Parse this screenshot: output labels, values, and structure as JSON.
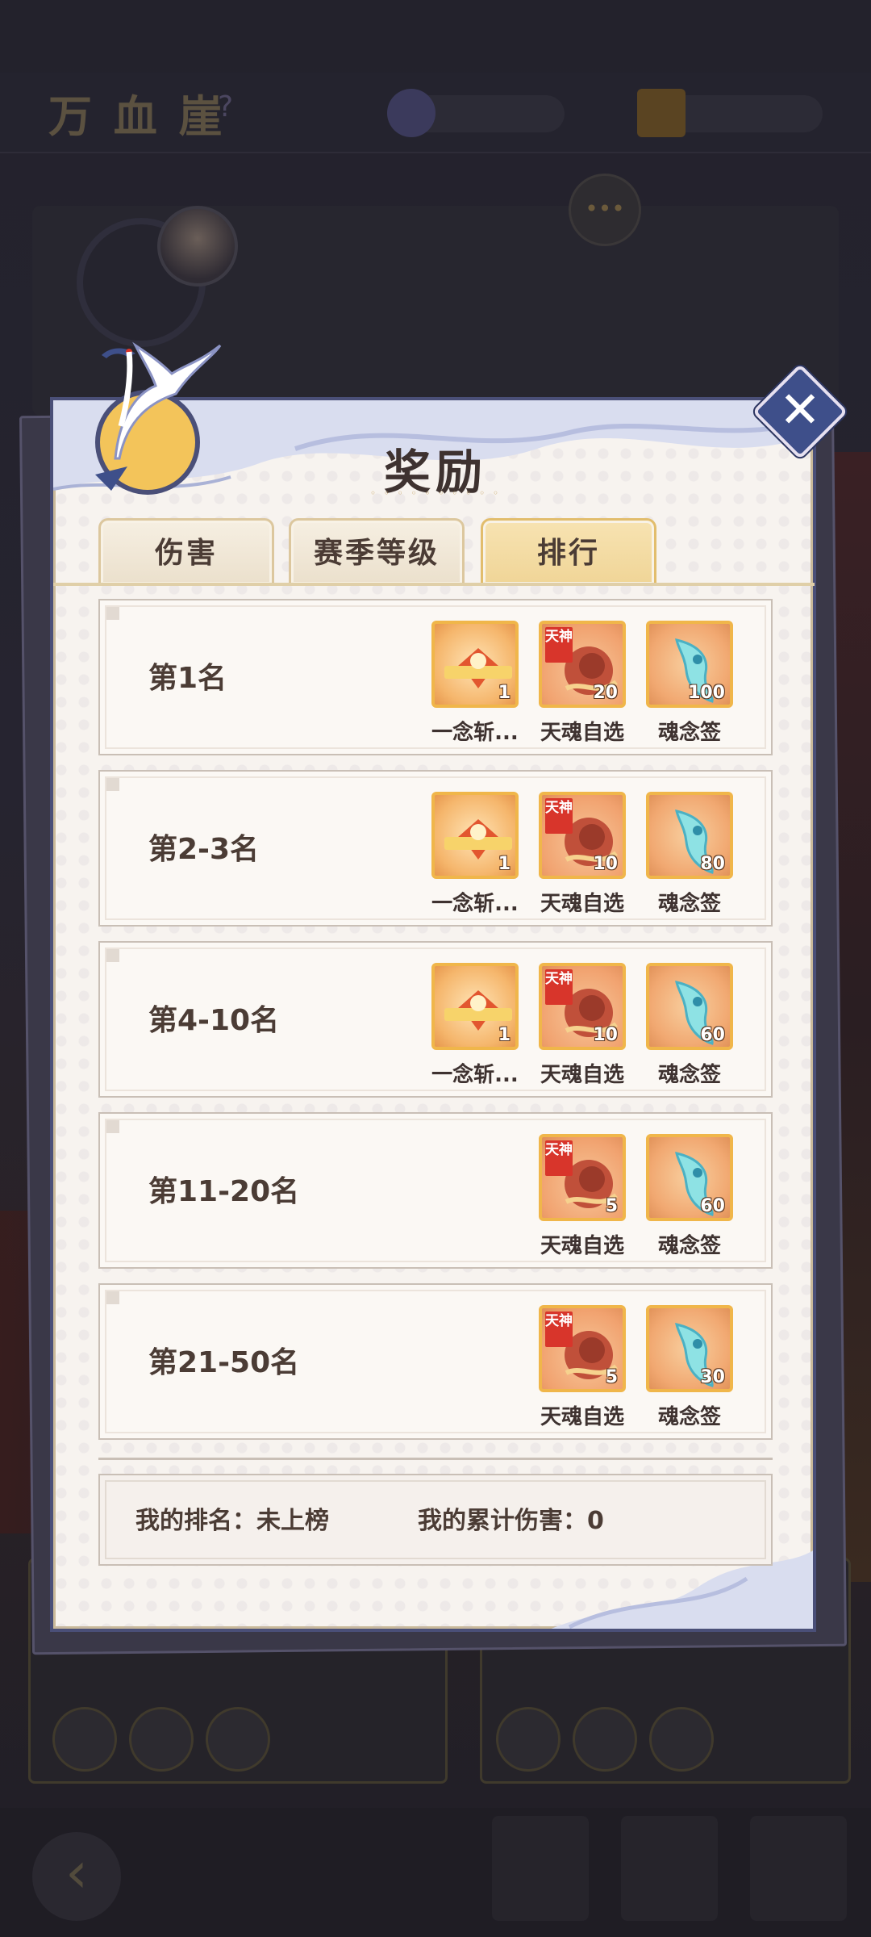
{
  "modal": {
    "title": "奖励",
    "tabs": [
      {
        "label": "伤害",
        "active": false
      },
      {
        "label": "赛季等级",
        "active": false
      },
      {
        "label": "排行",
        "active": true
      }
    ],
    "close_icon": "close-icon"
  },
  "rank_rewards": [
    {
      "rank": "第1名",
      "rewards": [
        {
          "icon": "yinian-item-icon",
          "style": "gold",
          "count": "1",
          "name": "一念斩..."
        },
        {
          "icon": "tianhun-select-icon",
          "style": "red",
          "tag": "天神",
          "count": "20",
          "name": "天魂自选"
        },
        {
          "icon": "hunnian-lot-icon",
          "style": "blue",
          "count": "100",
          "name": "魂念签"
        }
      ]
    },
    {
      "rank": "第2-3名",
      "rewards": [
        {
          "icon": "yinian-item-icon",
          "style": "gold",
          "count": "1",
          "name": "一念斩..."
        },
        {
          "icon": "tianhun-select-icon",
          "style": "red",
          "tag": "天神",
          "count": "10",
          "name": "天魂自选"
        },
        {
          "icon": "hunnian-lot-icon",
          "style": "blue",
          "count": "80",
          "name": "魂念签"
        }
      ]
    },
    {
      "rank": "第4-10名",
      "rewards": [
        {
          "icon": "yinian-item-icon",
          "style": "gold",
          "count": "1",
          "name": "一念斩..."
        },
        {
          "icon": "tianhun-select-icon",
          "style": "red",
          "tag": "天神",
          "count": "10",
          "name": "天魂自选"
        },
        {
          "icon": "hunnian-lot-icon",
          "style": "blue",
          "count": "60",
          "name": "魂念签"
        }
      ]
    },
    {
      "rank": "第11-20名",
      "rewards": [
        {
          "icon": "tianhun-select-icon",
          "style": "red",
          "tag": "天神",
          "count": "5",
          "name": "天魂自选"
        },
        {
          "icon": "hunnian-lot-icon",
          "style": "blue",
          "count": "60",
          "name": "魂念签"
        }
      ]
    },
    {
      "rank": "第21-50名",
      "rewards": [
        {
          "icon": "tianhun-select-icon",
          "style": "red",
          "tag": "天神",
          "count": "5",
          "name": "天魂自选"
        },
        {
          "icon": "hunnian-lot-icon",
          "style": "blue",
          "count": "30",
          "name": "魂念签"
        }
      ]
    }
  ],
  "my_info": {
    "rank_text": "我的排名：未上榜",
    "damage_text": "我的累计伤害：0"
  },
  "colors": {
    "modal_border": "#4a4f78",
    "active_tab": "#f0d597",
    "tile_border": "#f0b64a",
    "tag_red": "#d8352b"
  }
}
